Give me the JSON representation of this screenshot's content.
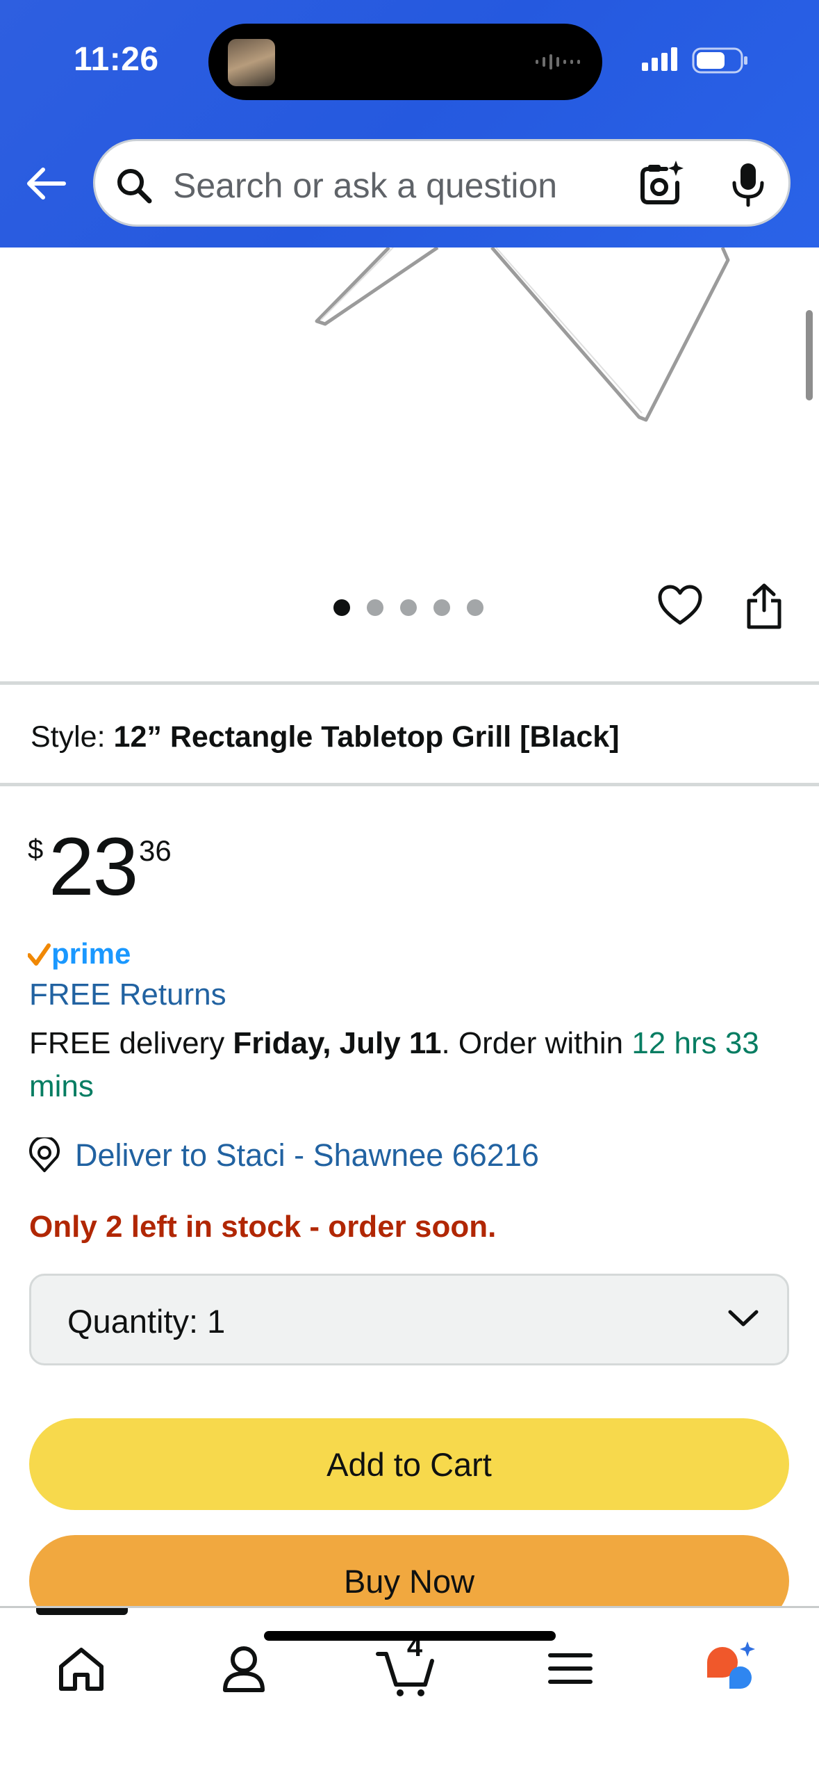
{
  "status_bar": {
    "time": "11:26"
  },
  "search": {
    "placeholder": "Search or ask a question"
  },
  "carousel": {
    "total": 5,
    "active_index": 0
  },
  "style": {
    "label": "Style:",
    "value": "12” Rectangle Tabletop Grill [Black]"
  },
  "price": {
    "symbol": "$",
    "whole": "23",
    "fraction": "36"
  },
  "prime_label": "prime",
  "free_returns": "FREE Returns",
  "delivery": {
    "prefix": "FREE delivery ",
    "date": "Friday, July 11",
    "middle": ". Order within ",
    "countdown": "12 hrs 33 mins"
  },
  "deliver_to": "Deliver to Staci - Shawnee 66216",
  "stock_message": "Only 2 left in stock - order soon.",
  "quantity": {
    "label": "Quantity: 1"
  },
  "buttons": {
    "add_to_cart": "Add to Cart",
    "buy_now": "Buy Now"
  },
  "tabbar": {
    "cart_count": "4"
  },
  "colors": {
    "header_blue": "#2559df",
    "link_blue": "#2162a1",
    "stock_red": "#b12704",
    "countdown_green": "#067d62",
    "add_to_cart_yellow": "#f7d94c",
    "buy_now_orange": "#f1a83f"
  }
}
